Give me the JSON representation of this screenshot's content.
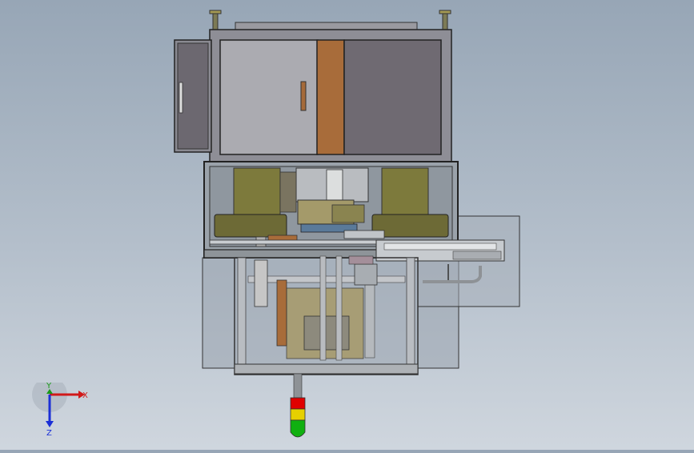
{
  "viewport": {
    "title": "",
    "background_top": "#97a6b6",
    "background_bottom": "#cfd6de"
  },
  "triad": {
    "x_label": "X",
    "y_label": "Y",
    "z_label": "Z",
    "x_color": "#d11919",
    "y_color": "#1a9a1a",
    "z_color": "#1b2fd6"
  },
  "model": {
    "cabinet_color": "#8e8e96",
    "door_color": "#6f6a72",
    "wood_color": "#a86c3a",
    "drum_color": "#7d7a3c",
    "frame_color": "#6a6e74",
    "signal_tower": [
      "#e00000",
      "#e6d000",
      "#10b010"
    ]
  }
}
